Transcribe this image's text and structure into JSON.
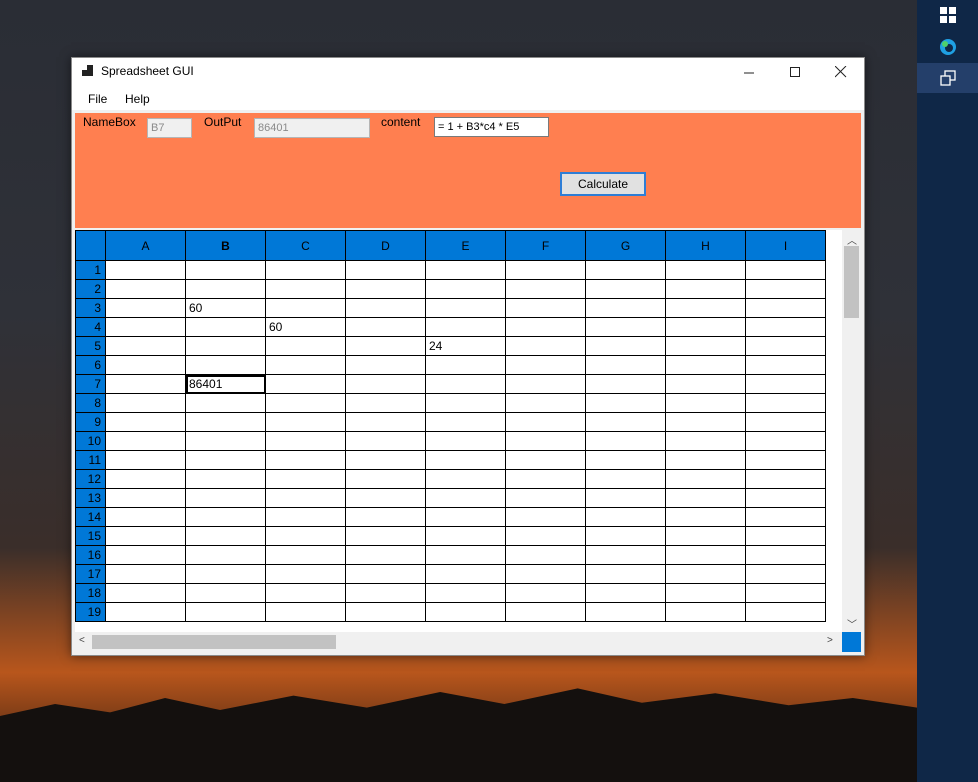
{
  "window": {
    "title": "Spreadsheet GUI"
  },
  "menu": {
    "items": [
      "File",
      "Help"
    ]
  },
  "toolbar": {
    "namebox_label": "NameBox",
    "namebox_value": "B7",
    "output_label": "OutPut",
    "output_value": "86401",
    "content_label": "content",
    "content_value": "= 1 + B3*c4 * E5",
    "calculate_label": "Calculate",
    "background_color": "#ff7f50"
  },
  "grid": {
    "columns": [
      "A",
      "B",
      "C",
      "D",
      "E",
      "F",
      "G",
      "H",
      "I"
    ],
    "selected_column": "B",
    "rows": [
      1,
      2,
      3,
      4,
      5,
      6,
      7,
      8,
      9,
      10,
      11,
      12,
      13,
      14,
      15,
      16,
      17,
      18,
      19
    ],
    "header_color": "#0078d7",
    "cells": [
      {
        "ref": "B3",
        "value": "60"
      },
      {
        "ref": "C4",
        "value": "60"
      },
      {
        "ref": "E5",
        "value": "24"
      },
      {
        "ref": "B7",
        "value": "86401"
      }
    ],
    "active_cell": "B7"
  }
}
